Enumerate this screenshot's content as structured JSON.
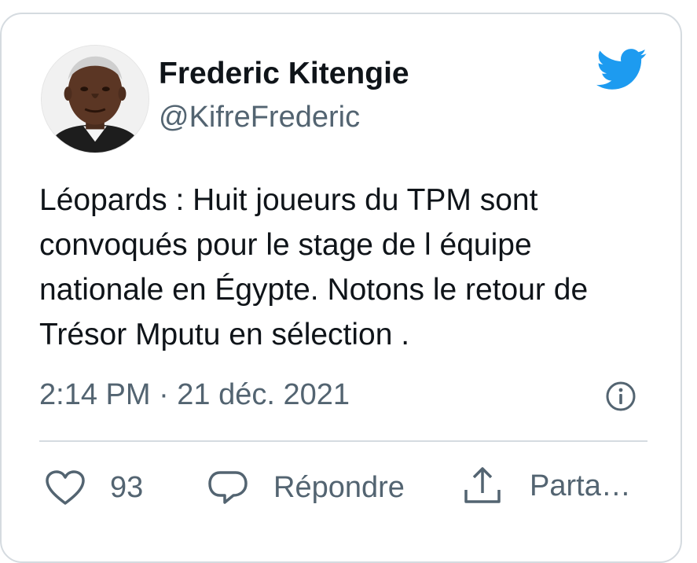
{
  "author": {
    "display_name": "Frederic Kitengie",
    "handle": "@KifreFrederic",
    "avatar_alt": "profile photo"
  },
  "tweet": {
    "text": "Léopards : Huit joueurs du TPM sont convoqués pour le stage de l équipe nationale en Égypte. Notons le retour de Trésor Mputu en sélection .",
    "timestamp": "2:14 PM · 21 déc. 2021"
  },
  "actions": {
    "like_count": "93",
    "reply_label": "Répondre",
    "share_label": "Parta…"
  },
  "icons": {
    "brand": "twitter-bird-icon",
    "info": "info-icon",
    "like": "heart-icon",
    "reply": "speech-bubble-icon",
    "share": "share-upload-icon"
  },
  "colors": {
    "twitter_blue": "#1d9bf0",
    "text_primary": "#0f1419",
    "text_secondary": "#536471",
    "border": "#d5dbe0"
  }
}
